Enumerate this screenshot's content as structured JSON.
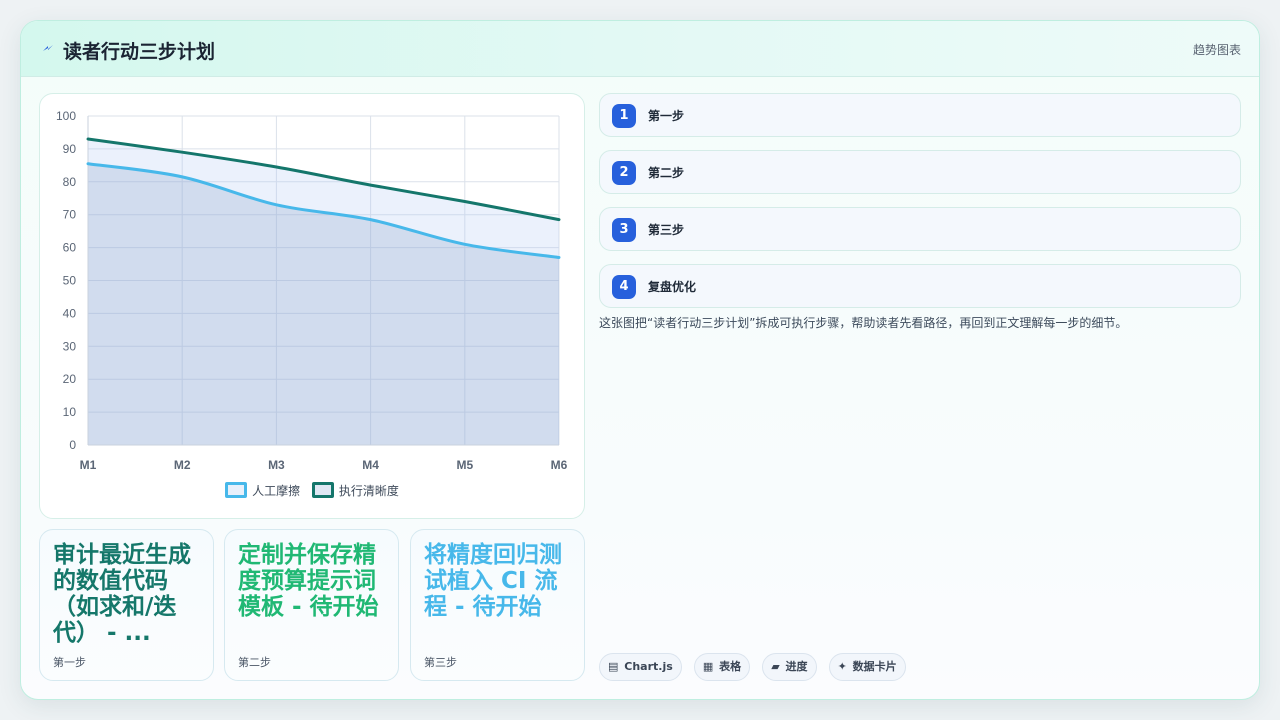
{
  "header": {
    "title": "读者行动三步计划",
    "tag": "趋势图表"
  },
  "colors": {
    "accent": "#2760dc",
    "series_1": "#47b8ea",
    "series_2": "#14766b",
    "card_1": "#15776a",
    "card_2": "#20b874",
    "card_3": "#47b8ea"
  },
  "chart_data": {
    "type": "area",
    "x": [
      "M1",
      "M2",
      "M3",
      "M4",
      "M5",
      "M6"
    ],
    "ylim": [
      0,
      100
    ],
    "yticks": [
      0,
      10,
      20,
      30,
      40,
      50,
      60,
      70,
      80,
      90,
      100
    ],
    "grid": true,
    "legend": "bottom",
    "series": [
      {
        "name": "人工摩擦",
        "values": [
          85.5,
          81.5,
          73,
          68.5,
          61,
          57
        ],
        "color": "#47b8ea"
      },
      {
        "name": "执行清晰度",
        "values": [
          93,
          89,
          84.5,
          79,
          74,
          68.5
        ],
        "color": "#14766b"
      }
    ]
  },
  "steps": [
    {
      "num": "1",
      "label": "第一步"
    },
    {
      "num": "2",
      "label": "第二步"
    },
    {
      "num": "3",
      "label": "第三步"
    },
    {
      "num": "4",
      "label": "复盘优化"
    }
  ],
  "description": "这张图把“读者行动三步计划”拆成可执行步骤，帮助读者先看路径，再回到正文理解每一步的细节。",
  "chips": [
    {
      "icon": "▤",
      "label": "Chart.js"
    },
    {
      "icon": "▦",
      "label": "表格"
    },
    {
      "icon": "▰",
      "label": "进度"
    },
    {
      "icon": "✦",
      "label": "数据卡片"
    }
  ],
  "cards": [
    {
      "title": "审计最近生成的数值代码（如求和/迭代） - ...",
      "caption": "第一步"
    },
    {
      "title": "定制并保存精度预算提示词模板 - 待开始",
      "caption": "第二步"
    },
    {
      "title": "将精度回归测试植入 CI 流程 - 待开始",
      "caption": "第三步"
    }
  ]
}
